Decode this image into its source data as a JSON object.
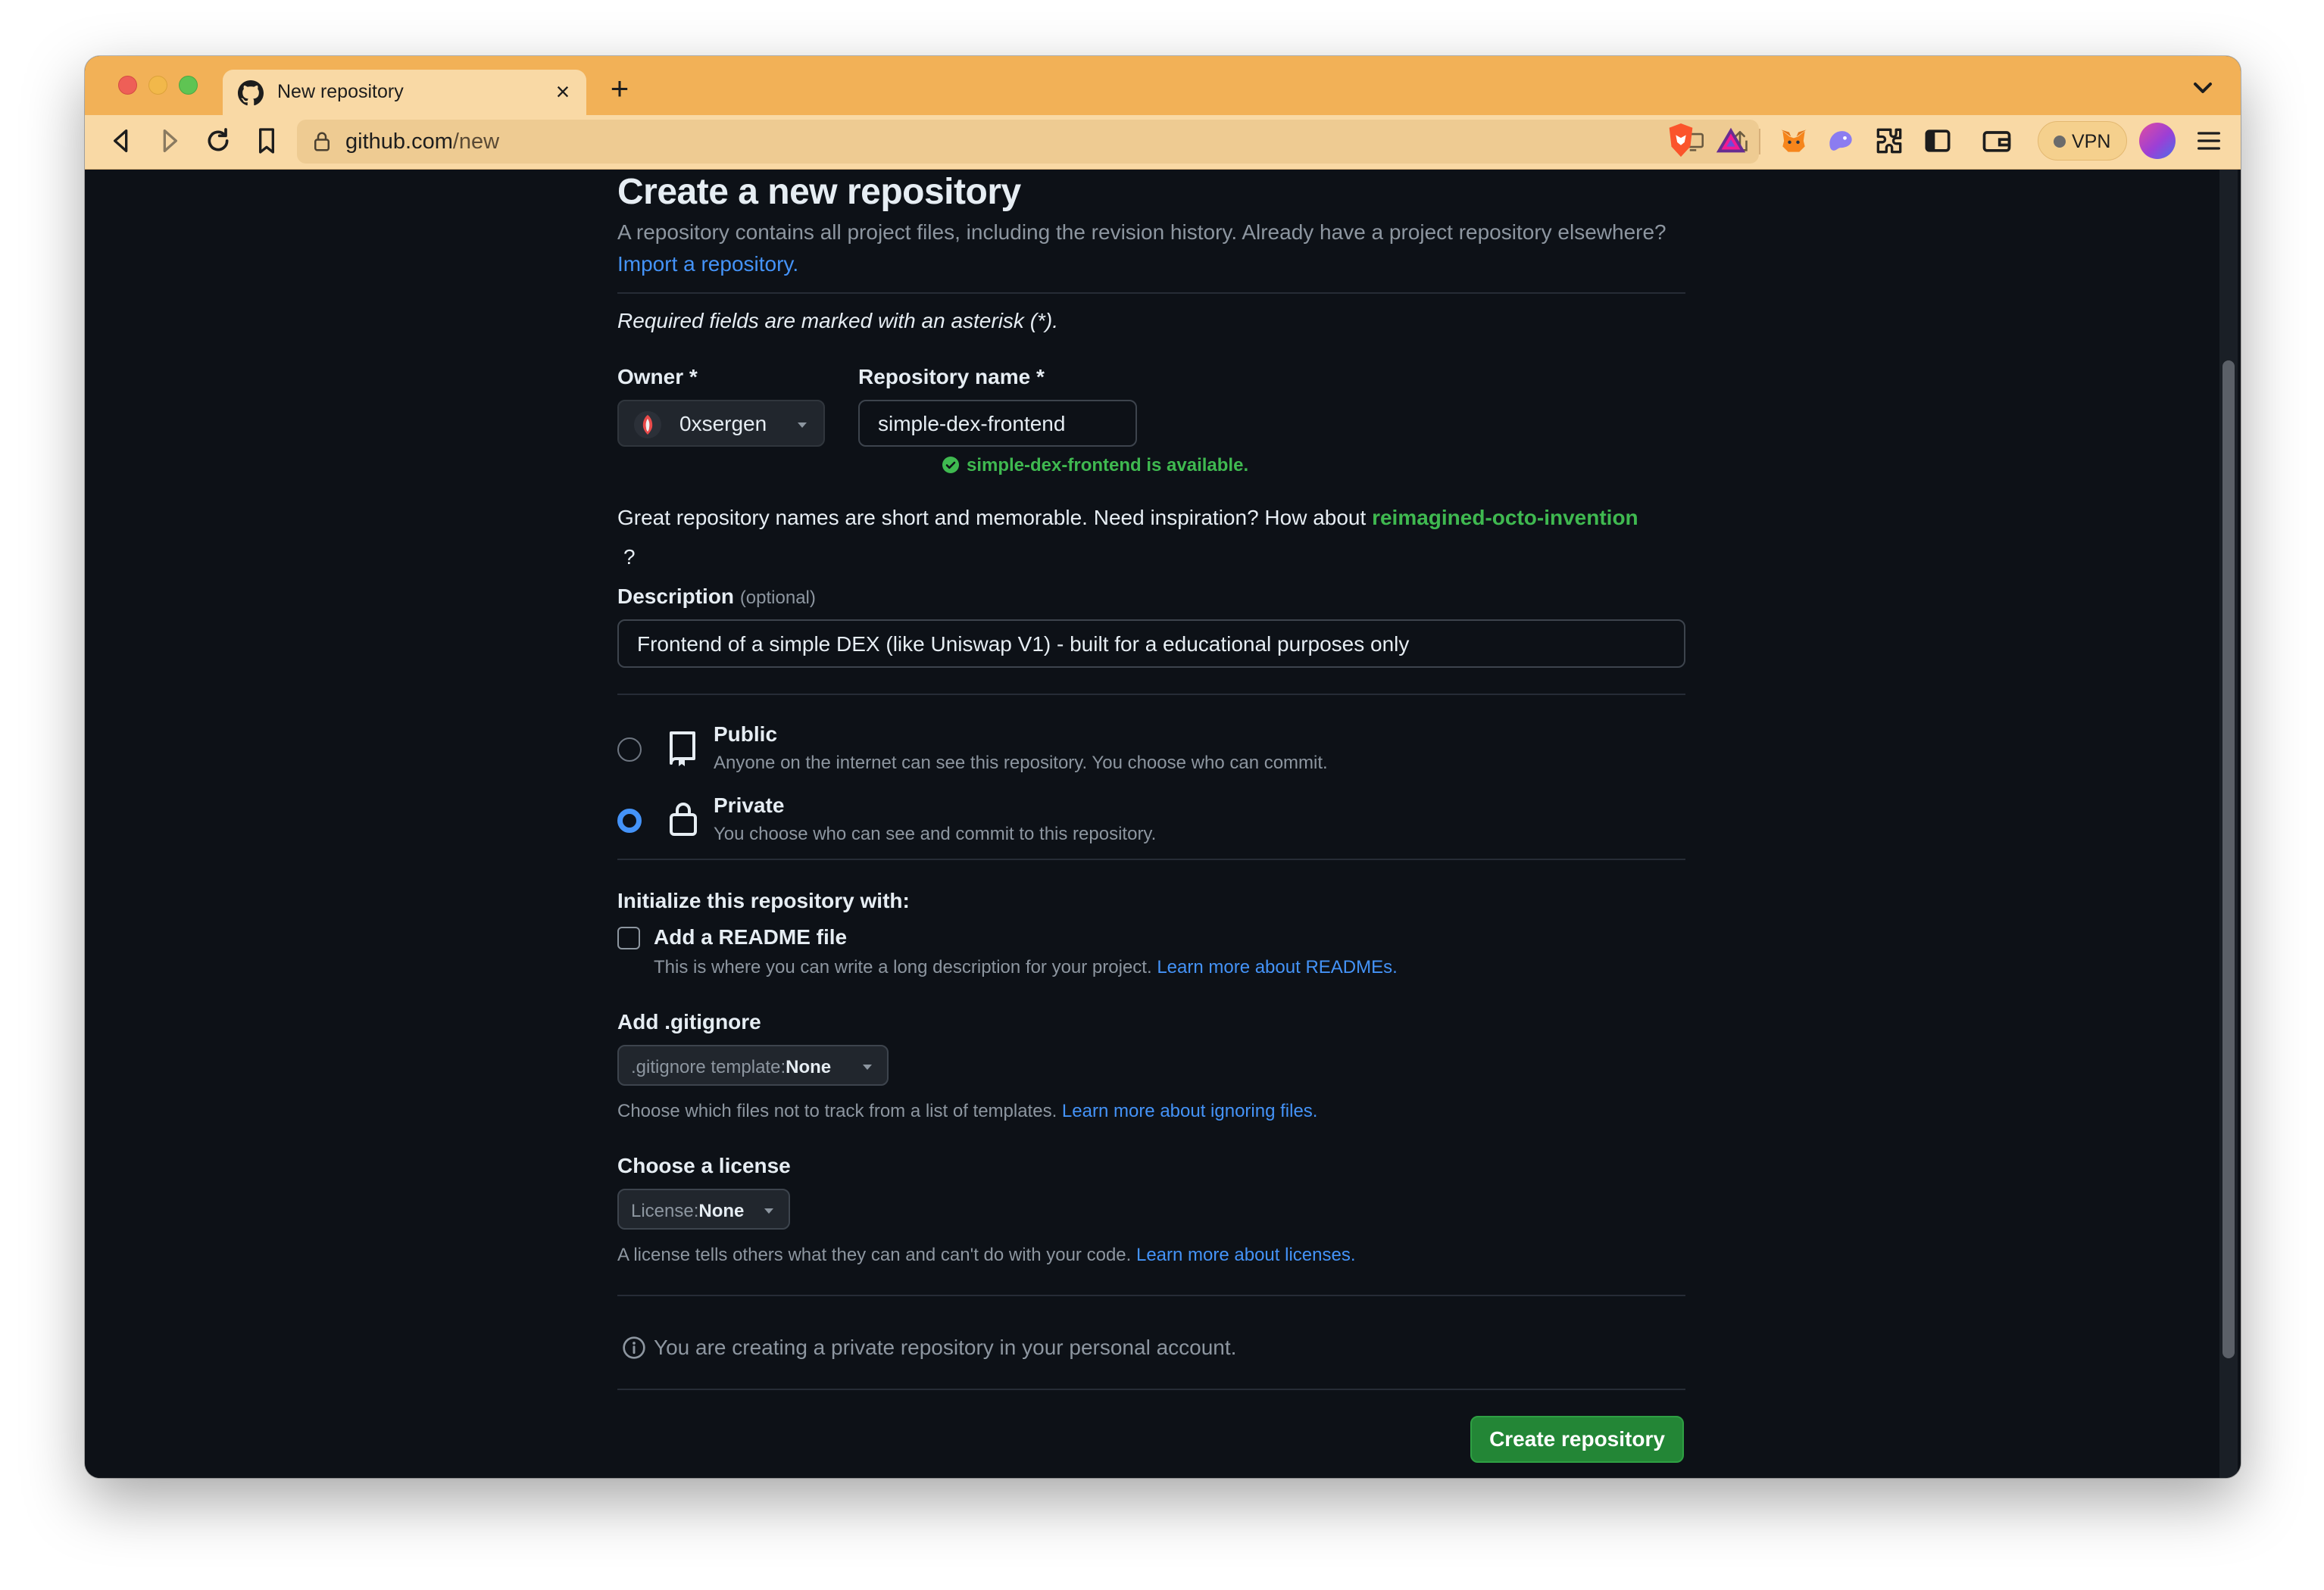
{
  "browser": {
    "tab_title": "New repository",
    "tab_close_glyph": "×",
    "new_tab_glyph": "+",
    "url_host": "github.com",
    "url_path": "/new",
    "vpn_label": "VPN"
  },
  "page": {
    "title": "Create a new repository",
    "lead_text": "A repository contains all project files, including the revision history. Already have a project repository elsewhere?",
    "import_link": "Import a repository.",
    "required_note": "Required fields are marked with an asterisk (*).",
    "owner_label": "Owner *",
    "owner_value": "0xsergen",
    "slash": "/",
    "repo_name_label": "Repository name *",
    "repo_name_value": "simple-dex-frontend",
    "availability": "simple-dex-frontend is available.",
    "inspiration_text": "Great repository names are short and memorable. Need inspiration? How about",
    "inspiration_suggestion": "reimagined-octo-invention",
    "inspiration_end": "?",
    "description_label": "Description",
    "description_optional": "(optional)",
    "description_value": "Frontend of a simple DEX (like Uniswap V1) - built for a educational purposes only",
    "visibility": {
      "public_title": "Public",
      "public_desc": "Anyone on the internet can see this repository. You choose who can commit.",
      "private_title": "Private",
      "private_desc": "You choose who can see and commit to this repository.",
      "selected": "private"
    },
    "init_title": "Initialize this repository with:",
    "readme_label": "Add a README file",
    "readme_desc": "This is where you can write a long description for your project.",
    "readme_link": "Learn more about READMEs.",
    "gitignore_title": "Add .gitignore",
    "gitignore_prefix": ".gitignore template:",
    "gitignore_value": "None",
    "gitignore_help": "Choose which files not to track from a list of templates.",
    "gitignore_link": "Learn more about ignoring files.",
    "license_title": "Choose a license",
    "license_prefix": "License:",
    "license_value": "None",
    "license_help": "A license tells others what they can and can't do with your code.",
    "license_link": "Learn more about licenses.",
    "info_text": "You are creating a private repository in your personal account.",
    "create_button": "Create repository"
  },
  "colors": {
    "background": "#0d1117",
    "text": "#e6edf3",
    "muted": "#8d96a0",
    "link": "#4493f8",
    "success": "#3fb950",
    "primary_button": "#238636",
    "browser_chrome": "#f2b157"
  },
  "icons": {
    "tab_favicon": "github-icon",
    "back": "back-icon",
    "forward": "forward-icon",
    "reload": "reload-icon",
    "bookmark": "bookmark-icon",
    "lock": "lock-icon",
    "public": "repo-icon",
    "private": "lock-icon",
    "info": "info-icon",
    "available": "check-circle-icon"
  }
}
